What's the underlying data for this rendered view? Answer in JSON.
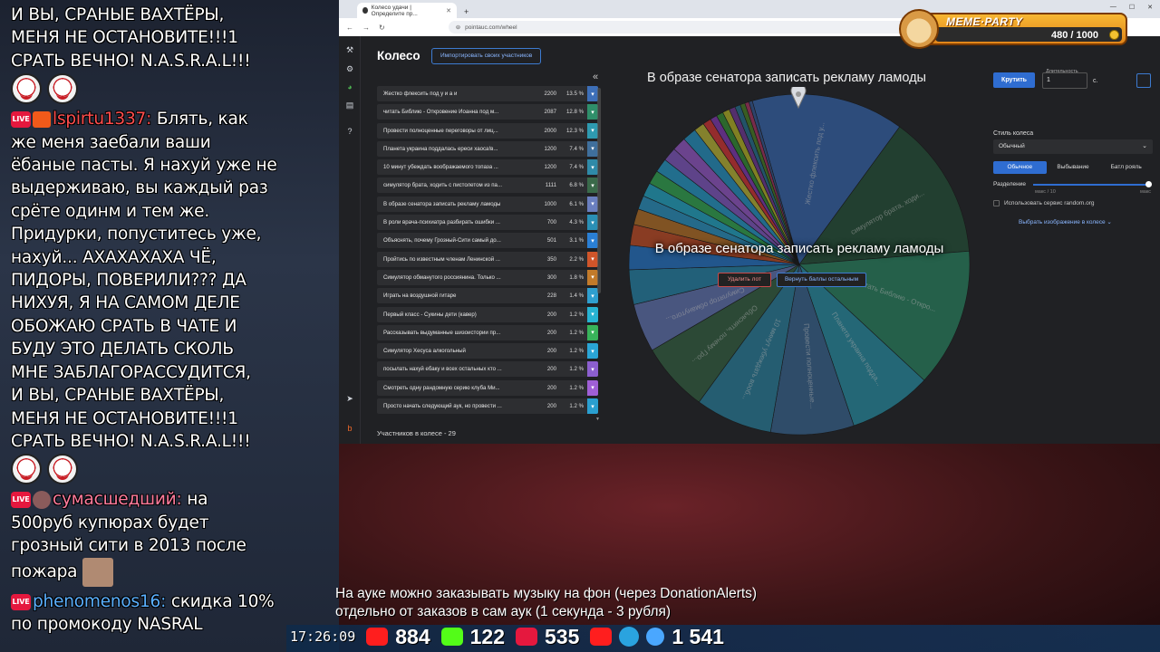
{
  "chat": {
    "messages": [
      {
        "lines": [
          "И ВЫ, СРАНЫЕ ВАХТЁРЫ,",
          "МЕНЯ НЕ ОСТАНОВИТЕ!!!1",
          "СРАТЬ ВЕЧНО! N.A.S.R.A.L!!!"
        ],
        "emotes": 2
      },
      {
        "user": "lspirtu1337",
        "text_lines": [
          "Блять, как",
          "же меня заебали ваши",
          "ёбаные пасты. Я нахуй уже не",
          "выдерживаю, вы каждый раз",
          "срёте одинм и тем же.",
          "Придурки, попуститесь уже,",
          "нахуй... АХАХАХАХА ЧЁ,",
          "ПИДОРЫ, ПОВЕРИЛИ??? ДА",
          "НИХУЯ, Я НА САМОМ ДЕЛЕ",
          "ОБОЖАЮ СРАТЬ В ЧАТЕ И",
          "БУДУ ЭТО ДЕЛАТЬ СКОЛЬ",
          "МНЕ ЗАБЛАГОРАССУДИТСЯ,",
          "И ВЫ, СРАНЫЕ ВАХТЁРЫ,",
          "МЕНЯ НЕ ОСТАНОВИТЕ!!!1",
          "СРАТЬ ВЕЧНО! N.A.S.R.A.L!!!"
        ],
        "emotes": 2
      },
      {
        "user": "сумасшедший",
        "text_lines": [
          "на",
          "500руб купюрах будет",
          "грозный сити в 2013 после",
          "пожара"
        ]
      },
      {
        "user": "phenomenos16",
        "text_lines": [
          "скидка 10%",
          "по промокоду NASRAL"
        ]
      }
    ],
    "live_badge": "LIVE"
  },
  "browser": {
    "tab_title": "Колесо удачи | Определите пр...",
    "url": "pointauc.com/wheel"
  },
  "app": {
    "heading": "Колесо",
    "import_button": "Импортировать своих участников",
    "collapse_icon": "«",
    "participants_count": "Участников в колесе - 29",
    "lots": [
      {
        "name": "Жестко флексить под у и а и",
        "amount": "2200",
        "percent": "13.5 %",
        "color": "#3d6fb8"
      },
      {
        "name": "читать Библию - Откровение Иоанна под м...",
        "amount": "2087",
        "percent": "12.8 %",
        "color": "#2f8f6a"
      },
      {
        "name": "Провести полноценные переговоры от лиц...",
        "amount": "2000",
        "percent": "12.3 %",
        "color": "#2e9ab0"
      },
      {
        "name": "Планета украина поддалась ереси хаоса!в...",
        "amount": "1200",
        "percent": "7.4 %",
        "color": "#3f6f9c"
      },
      {
        "name": "10 минут убеждать воображаемого топаза ...",
        "amount": "1200",
        "percent": "7.4 %",
        "color": "#2f8aa8"
      },
      {
        "name": "симулятор брата, ходить с пистолетом из па...",
        "amount": "1111",
        "percent": "6.8 %",
        "color": "#3a6a4a"
      },
      {
        "name": "В образе сенатора записать рекламу ламоды",
        "amount": "1000",
        "percent": "6.1 %",
        "color": "#6a7fbf"
      },
      {
        "name": "В роли врача-психиатра разбирать ошибки ...",
        "amount": "700",
        "percent": "4.3 %",
        "color": "#2a8fb5"
      },
      {
        "name": "Объяснять, почему Грозный-Сити самый до...",
        "amount": "501",
        "percent": "3.1 %",
        "color": "#2a7fd4"
      },
      {
        "name": "Пройтись по известным членам Ленинской ...",
        "amount": "350",
        "percent": "2.2 %",
        "color": "#d0552a"
      },
      {
        "name": "Симулятор обманутого россиянина. Только ...",
        "amount": "300",
        "percent": "1.8 %",
        "color": "#c27a2a"
      },
      {
        "name": "Играть на воздушной гитаре",
        "amount": "228",
        "percent": "1.4 %",
        "color": "#2f9fcf"
      },
      {
        "name": "Первый класс - Сукины дети (кавер)",
        "amount": "200",
        "percent": "1.2 %",
        "color": "#27b3d3"
      },
      {
        "name": "Рассказывать выдуманные шизоистории пр...",
        "amount": "200",
        "percent": "1.2 %",
        "color": "#38b35a"
      },
      {
        "name": "Симулятор Хесуса алкогольный",
        "amount": "200",
        "percent": "1.2 %",
        "color": "#2aa5d6"
      },
      {
        "name": "посылать нахуй ебаку и всех остальных кто ...",
        "amount": "200",
        "percent": "1.2 %",
        "color": "#8c5fcf"
      },
      {
        "name": "Смотреть одну рандомную серию клуба Ми...",
        "amount": "200",
        "percent": "1.2 %",
        "color": "#a05fd6"
      },
      {
        "name": "Просто начать следующий аук, но провести ...",
        "amount": "200",
        "percent": "1.2 %",
        "color": "#2a9fd0"
      }
    ],
    "wheel_title": "В образе сенатора записать рекламу ламоды",
    "wheel_overlay_text": "В образе сенатора записать рекламу ламоды",
    "delete_lot_button": "Удалить лот",
    "return_points_button": "Вернуть баллы остальным",
    "wheel_segment_colors": [
      "#3d6fb8",
      "#2b5a3f",
      "#2f8f6a",
      "#2e9ab0",
      "#3f6f9c",
      "#2f8aa8",
      "#3a6a4a",
      "#6a7fbf",
      "#2a8fb5",
      "#2a7fd4",
      "#d0552a",
      "#c27a2a",
      "#2f9fcf",
      "#27b3d3",
      "#38b35a",
      "#2aa5d6",
      "#8c5fcf",
      "#a05fd6",
      "#2a9fd0",
      "#c9c33a",
      "#e23a3a",
      "#8c3fbf",
      "#3a9a3a",
      "#c2c22a",
      "#7a3fa0",
      "#2a7a9a",
      "#4f8a2a",
      "#b53a6a",
      "#3a5fa0"
    ],
    "wheel_values": [
      2200,
      2087,
      2000,
      1200,
      1200,
      1111,
      1000,
      700,
      501,
      350,
      300,
      228,
      200,
      200,
      200,
      200,
      200,
      200,
      200,
      150,
      120,
      100,
      100,
      100,
      90,
      80,
      70,
      60,
      50
    ],
    "wheel_labels": [
      "Жестко флексить под у...",
      "симулятор брата, ходи...",
      "читать Библию - Откро...",
      "Планета украина подда...",
      "Провести полноценные...",
      "10 минут убеждать вооб...",
      "Объяснять, почему Гро...",
      "Симулятор обманутого..."
    ],
    "settings": {
      "spin_button": "Крутить",
      "duration_label": "Длительность",
      "duration_value": "1",
      "duration_unit": "с.",
      "style_label": "Стиль колеса",
      "style_value": "Обычный",
      "modes": [
        "Обычное",
        "Выбывание",
        "Батл рояль"
      ],
      "split_label": "Разделение",
      "split_min": "макс / 10",
      "split_max": "макс",
      "split_fraction": 1.0,
      "random_org_label": "Использовать сервис random.org",
      "image_link": "Выбрать изображение в колесе"
    }
  },
  "overlay": {
    "meme_party_title": "MEME·PARTY",
    "meme_party_score": "480 / 1000",
    "caption_lines": [
      "На ауке можно заказывать музыку на фон (через DonationAlerts)",
      "отдельно от заказов в сам аук (1 секунда - 3 рубля)"
    ],
    "clock": "17:26:09",
    "stats": [
      {
        "icon": "youtube-icon",
        "value": "884"
      },
      {
        "icon": "kick-icon",
        "value": "122"
      },
      {
        "icon": "live-icon",
        "value": "535"
      },
      {
        "icon": "rutube-icon",
        "value": ""
      },
      {
        "icon": "telegram-icon",
        "value": ""
      },
      {
        "icon": "viewers-icon",
        "value": "1 541"
      }
    ]
  }
}
